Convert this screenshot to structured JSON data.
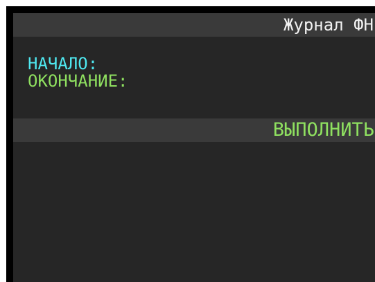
{
  "header": {
    "title": "Журнал ФН"
  },
  "form": {
    "start_label": "НАЧАЛО:",
    "end_label": "ОКОНЧАНИЕ:"
  },
  "actions": {
    "execute_label": "ВЫПОЛНИТЬ"
  },
  "colors": {
    "background": "#262626",
    "bar": "#3a3a3a",
    "title_text": "#f2f2f2",
    "start_label": "#4fe8f0",
    "end_label": "#8fe060",
    "execute_text": "#8fe060"
  }
}
